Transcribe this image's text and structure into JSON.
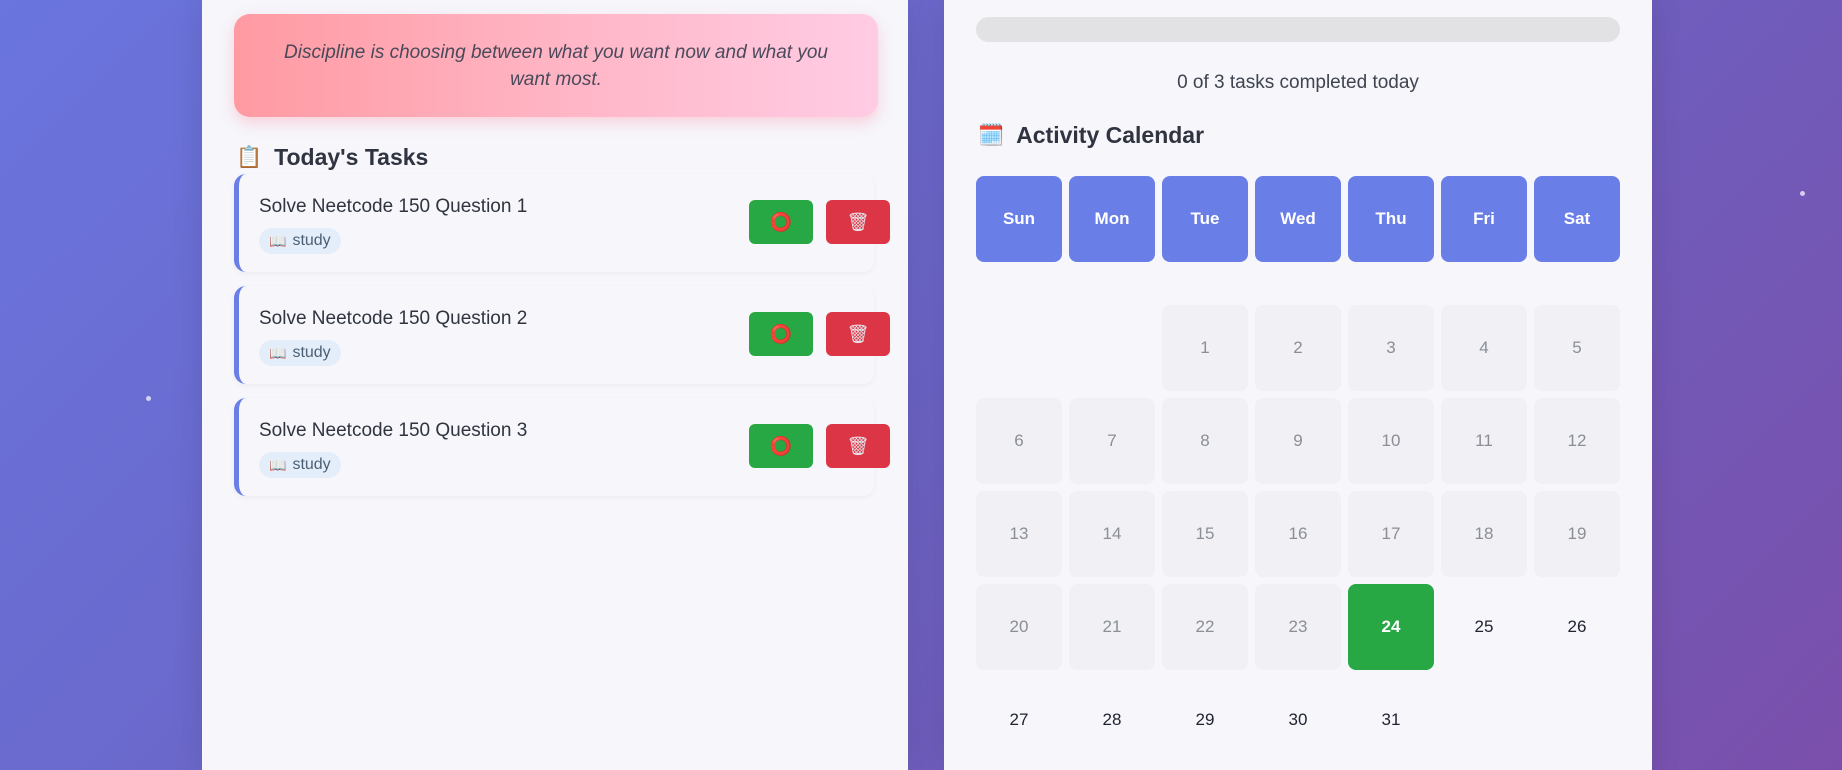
{
  "quote": {
    "text": "Discipline is choosing between what you want now and what you want most."
  },
  "tasks_section": {
    "icon": "clipboard-icon",
    "emoji": "📋",
    "title": "Today's Tasks",
    "tasks": [
      {
        "title": "Solve Neetcode 150 Question 1",
        "category_icon": "📖",
        "category": "study",
        "done_icon": "⭕",
        "delete_icon": "🗑"
      },
      {
        "title": "Solve Neetcode 150 Question 2",
        "category_icon": "📖",
        "category": "study",
        "done_icon": "⭕",
        "delete_icon": "🗑"
      },
      {
        "title": "Solve Neetcode 150 Question 3",
        "category_icon": "📖",
        "category": "study",
        "done_icon": "⭕",
        "delete_icon": "🗑"
      }
    ]
  },
  "progress": {
    "completed_fraction": 0,
    "text": "0 of 3 tasks completed today"
  },
  "calendar": {
    "icon": "calendar-icon",
    "emoji": "🗓️",
    "title": "Activity Calendar",
    "weekdays": [
      "Sun",
      "Mon",
      "Tue",
      "Wed",
      "Thu",
      "Fri",
      "Sat"
    ],
    "days": [
      "1",
      "2",
      "3",
      "4",
      "5",
      "6",
      "7",
      "8",
      "9",
      "10",
      "11",
      "12",
      "13",
      "14",
      "15",
      "16",
      "17",
      "18",
      "19",
      "20",
      "21",
      "22",
      "23",
      "24",
      "25",
      "26",
      "27",
      "28",
      "29",
      "30",
      "31"
    ],
    "first_weekday_index": 2,
    "today": "24"
  },
  "colors": {
    "accent": "#6a7ee8",
    "success": "#28a745",
    "danger": "#dc3545",
    "background_gradient": [
      "#6a75de",
      "#7a4fab"
    ]
  }
}
